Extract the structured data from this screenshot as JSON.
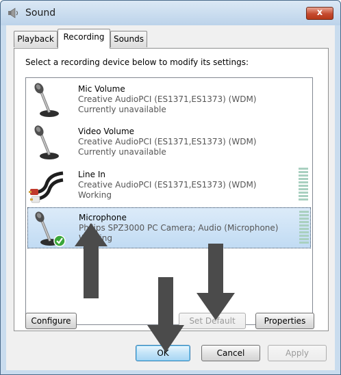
{
  "window": {
    "title": "Sound",
    "close_label": "x"
  },
  "tabs": [
    {
      "label": "Playback"
    },
    {
      "label": "Recording"
    },
    {
      "label": "Sounds"
    }
  ],
  "instruction": "Select a recording device below to modify its settings:",
  "devices": [
    {
      "name": "Mic Volume",
      "description": "Creative AudioPCI (ES1371,ES1373) (WDM)",
      "status": "Currently unavailable",
      "icon": "microphone-icon"
    },
    {
      "name": "Video Volume",
      "description": "Creative AudioPCI (ES1371,ES1373) (WDM)",
      "status": "Currently unavailable",
      "icon": "microphone-icon"
    },
    {
      "name": "Line In",
      "description": "Creative AudioPCI (ES1371,ES1373) (WDM)",
      "status": "Working",
      "icon": "rca-cable-icon"
    },
    {
      "name": "Microphone",
      "description": "Philips SPZ3000 PC Camera; Audio (Microphone)",
      "status": "Working",
      "icon": "microphone-default-icon",
      "selected": true
    }
  ],
  "buttons": {
    "configure": "Configure",
    "set_default": "Set Default",
    "properties": "Properties",
    "ok": "OK",
    "cancel": "Cancel",
    "apply": "Apply"
  },
  "colors": {
    "selection": "#c1dbf3",
    "default_check": "#3aa63a",
    "annotation_arrow": "#4b4b4b"
  }
}
